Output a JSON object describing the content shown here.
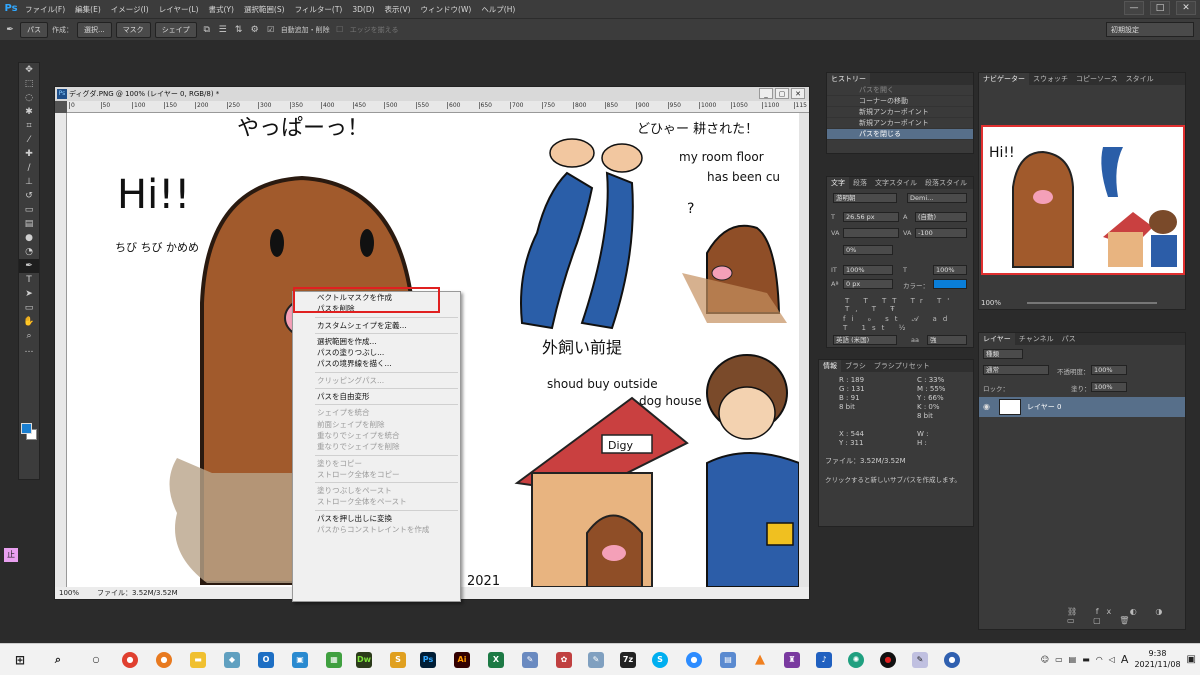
{
  "menubar": {
    "logo": "Ps",
    "items": [
      "ファイル(F)",
      "編集(E)",
      "イメージ(I)",
      "レイヤー(L)",
      "書式(Y)",
      "選択範囲(S)",
      "フィルター(T)",
      "3D(D)",
      "表示(V)",
      "ウィンドウ(W)",
      "ヘルプ(H)"
    ],
    "window_buttons": [
      "—",
      "□",
      "✕"
    ]
  },
  "options": {
    "mode_value": "パス",
    "create_label": "作成：",
    "select_btn": "選択...",
    "mask_btn": "マスク",
    "shape_btn": "シェイプ",
    "auto_add_label": "自動追加・削除",
    "align_edges_label": "エッジを揃える",
    "workspace": "初期設定"
  },
  "document": {
    "title": "ディグダ.PNG @ 100% (レイヤー 0, RGB/8) *",
    "ruler_ticks": [
      "0",
      "50",
      "100",
      "150",
      "200",
      "250",
      "300",
      "350",
      "400",
      "450",
      "500",
      "550",
      "600",
      "650",
      "700",
      "750",
      "800",
      "850",
      "900",
      "950",
      "1000",
      "1050",
      "1100",
      "115"
    ],
    "status_zoom": "100%",
    "status_file": "ファイル：3.52M/3.52M",
    "canvas_texts": {
      "top": "やっぱーっ！",
      "hi": "Hi!!",
      "left_note": "ちび ちび かめめ",
      "top_right": "どひゃー 耕された！",
      "room": "my room floor",
      "cut": "has been cu",
      "question": "?",
      "outside_jp": "外飼い前提",
      "outside_en1": "shoud buy outside",
      "outside_en2": "dog house",
      "digy": "Digy",
      "year": "2021"
    }
  },
  "context_menu": {
    "items": [
      {
        "label": "ベクトルマスクを作成",
        "enabled": true
      },
      {
        "label": "パスを削除",
        "enabled": true
      },
      {
        "sep": true
      },
      {
        "label": "カスタムシェイプを定義...",
        "enabled": true
      },
      {
        "sep": true
      },
      {
        "label": "選択範囲を作成...",
        "enabled": true
      },
      {
        "label": "パスの塗りつぶし...",
        "enabled": true
      },
      {
        "label": "パスの境界線を描く...",
        "enabled": true
      },
      {
        "sep": true
      },
      {
        "label": "クリッピングパス...",
        "enabled": false
      },
      {
        "sep": true
      },
      {
        "label": "パスを自由変形",
        "enabled": true
      },
      {
        "sep": true
      },
      {
        "label": "シェイプを統合",
        "enabled": false
      },
      {
        "label": "前面シェイプを削除",
        "enabled": false
      },
      {
        "label": "重なりでシェイプを統合",
        "enabled": false
      },
      {
        "label": "重なりでシェイプを削除",
        "enabled": false
      },
      {
        "sep": true
      },
      {
        "label": "塗りをコピー",
        "enabled": false
      },
      {
        "label": "ストローク全体をコピー",
        "enabled": false
      },
      {
        "sep": true
      },
      {
        "label": "塗りつぶしをペースト",
        "enabled": false
      },
      {
        "label": "ストローク全体をペースト",
        "enabled": false
      },
      {
        "sep": true
      },
      {
        "label": "パスを押し出しに変換",
        "enabled": true
      },
      {
        "label": "パスからコンストレイントを作成",
        "enabled": false
      }
    ]
  },
  "history": {
    "tab": "ヒストリー",
    "items": [
      "パスを開く",
      "コーナーの移動",
      "新規アンカーポイント",
      "新規アンカーポイント",
      "パスを閉じる"
    ]
  },
  "character": {
    "tabs": [
      "文字",
      "段落",
      "文字スタイル",
      "段落スタイル"
    ],
    "font": "游明朝",
    "font_style": "Demi...",
    "size": "26.56 px",
    "leading": "(自動)",
    "tracking": "-100",
    "kerning": "0%",
    "vscale": "100%",
    "hscale": "100%",
    "baseline": "0 px",
    "color_label": "カラー：",
    "lang": "英語 (米国)",
    "aa": "強",
    "aa_label": "aa"
  },
  "navigator": {
    "tabs": [
      "ナビゲーター",
      "スウォッチ",
      "コピーソース",
      "スタイル"
    ],
    "zoom": "100%",
    "thumb_hi": "Hi!!"
  },
  "info": {
    "tabs": [
      "情報",
      "ブラシ",
      "ブラシプリセット"
    ],
    "R": "189",
    "G": "131",
    "B": "91",
    "C": "33%",
    "M": "55%",
    "Y": "66%",
    "K": "0%",
    "bits1": "8 bit",
    "bits2": "8 bit",
    "X": "544",
    "Y2": "311",
    "file": "ファイル：3.52M/3.52M",
    "hint": "クリックすると新しいサブパスを作成します。"
  },
  "layers": {
    "tabs": [
      "レイヤー",
      "チャンネル",
      "パス"
    ],
    "kind": "種類",
    "blend": "通常",
    "opacity_label": "不透明度：",
    "opacity": "100%",
    "lock_label": "ロック：",
    "fill_label": "塗り：",
    "fill": "100%",
    "layer_name": "レイヤー 0"
  },
  "taskbar": {
    "time": "9:38",
    "date": "2021/11/08",
    "lang": "A",
    "ime": "止"
  },
  "colors": {
    "accent": "#31a8ff",
    "highlight_box": "#e02020",
    "swatch_fg": "#1a7fd1"
  }
}
